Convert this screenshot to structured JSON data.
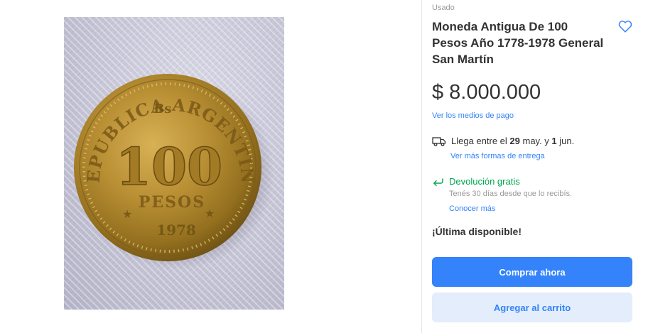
{
  "product": {
    "condition": "Usado",
    "title": "Moneda Antigua De 100 Pesos Año 1778-1978 General San Martín",
    "price_currency": "$",
    "price_amount": "8.000.000",
    "payment_link": "Ver los medios de pago"
  },
  "shipping": {
    "prefix": "Llega entre el ",
    "date_from": "29",
    "middle": " may. y ",
    "date_to": "1",
    "suffix": " jun.",
    "link": "Ver más formas de entrega"
  },
  "returns": {
    "title": "Devolución gratis",
    "subtitle": "Tenés 30 días desde que lo recibís.",
    "link": "Conocer más"
  },
  "stock": {
    "label": "¡Última disponible!"
  },
  "actions": {
    "buy_label": "Comprar ahora",
    "cart_label": "Agregar al carrito"
  },
  "coin": {
    "country": "REPUBLICA ARGENTINA",
    "mint_mark": "Bs",
    "denomination": "100",
    "unit": "PESOS",
    "year": "1978"
  },
  "icons": {
    "favorite": "heart-icon",
    "shipping": "truck-icon",
    "returns": "return-arrow-icon"
  },
  "colors": {
    "accent": "#3483fa",
    "success": "#00a650",
    "accent_light": "#e3edfb",
    "text": "#333333",
    "muted": "#999999"
  }
}
